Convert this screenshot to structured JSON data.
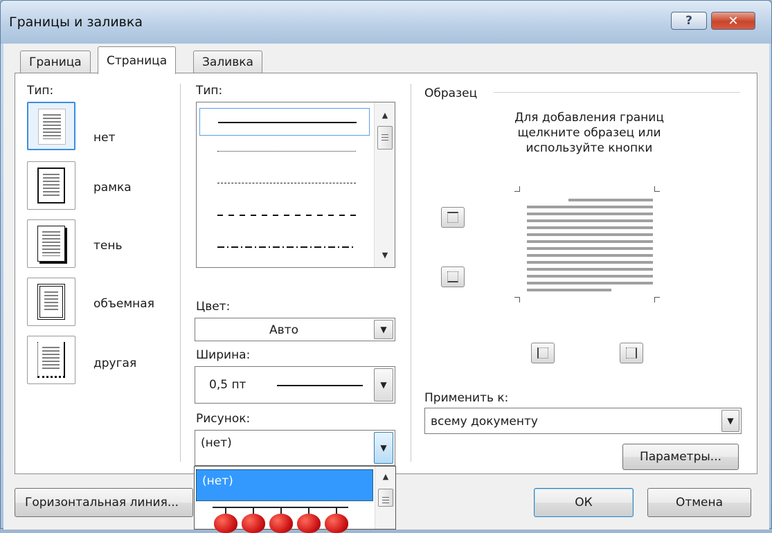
{
  "window": {
    "title": "Границы и заливка",
    "help_glyph": "?",
    "close_glyph": "✕"
  },
  "tabs": [
    {
      "label": "Граница",
      "active": false
    },
    {
      "label": "Страница",
      "active": true
    },
    {
      "label": "Заливка",
      "active": false
    }
  ],
  "setting": {
    "label": "Тип:",
    "items": [
      {
        "label": "нет",
        "selected": true
      },
      {
        "label": "рамка",
        "selected": false
      },
      {
        "label": "тень",
        "selected": false
      },
      {
        "label": "объемная",
        "selected": false
      },
      {
        "label": "другая",
        "selected": false
      }
    ]
  },
  "style": {
    "label": "Тип:",
    "options": [
      "solid",
      "dotted",
      "dashed-small",
      "dashed",
      "dash-dot"
    ],
    "selected": "solid"
  },
  "color": {
    "label": "Цвет:",
    "value": "Авто"
  },
  "width": {
    "label": "Ширина:",
    "value": "0,5 пт"
  },
  "art": {
    "label": "Рисунок:",
    "value": "(нет)",
    "list_selected": "(нет)"
  },
  "preview": {
    "label": "Образец",
    "hint": "Для добавления границ щелкните образец или используйте кнопки"
  },
  "apply_to": {
    "label": "Применить к:",
    "value": "всему документу"
  },
  "buttons": {
    "options": "Параметры...",
    "horizontal_line": "Горизонтальная линия...",
    "ok": "ОК",
    "cancel": "Отмена"
  },
  "colors": {
    "selection": "#3399ff",
    "close": "#c8452c"
  }
}
